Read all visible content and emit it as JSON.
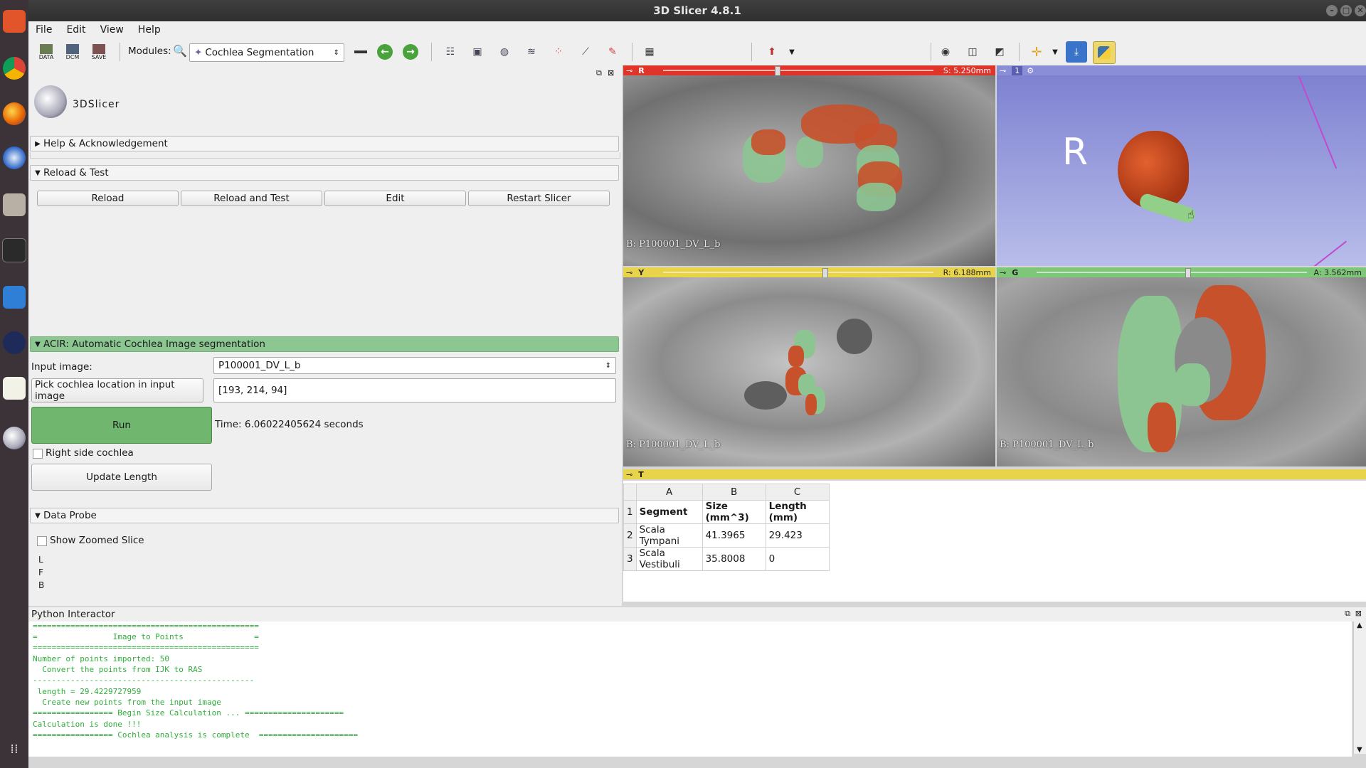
{
  "window": {
    "title": "3D Slicer 4.8.1"
  },
  "menu": [
    "File",
    "Edit",
    "View",
    "Help"
  ],
  "toolbar": {
    "data_label": "DATA",
    "dcm_label": "DCM",
    "save_label": "SAVE",
    "modules_label": "Modules:",
    "module_selected": "Cochlea Segmentation"
  },
  "logo": {
    "text": "3DSlicer"
  },
  "sections": {
    "help": "Help & Acknowledgement",
    "reload_test": "Reload & Test",
    "acir": "ACIR: Automatic Cochlea Image segmentation",
    "data_probe": "Data Probe"
  },
  "reload_buttons": [
    "Reload",
    "Reload and Test",
    "Edit",
    "Restart Slicer"
  ],
  "acir": {
    "input_image_label": "Input image:",
    "input_image_value": "P100001_DV_L_b",
    "pick_button": "Pick cochlea location in input image",
    "location_value": "[193, 214, 94]",
    "run_button": "Run",
    "time_text": "Time: 6.06022405624  seconds",
    "right_side_label": "Right side cochlea",
    "update_length_button": "Update Length"
  },
  "data_probe": {
    "show_zoomed_label": "Show Zoomed Slice",
    "lines": [
      "L",
      "F",
      "B"
    ]
  },
  "views": {
    "red": {
      "letter": "R",
      "offset": "S: 5.250mm",
      "label": "B: P100001_DV_L_b",
      "slider": 0.42
    },
    "threed": {
      "num": "1",
      "orient": "R"
    },
    "yellow": {
      "letter": "Y",
      "offset": "R: 6.188mm",
      "label": "B: P100001_DV_L_b",
      "slider": 0.6
    },
    "green": {
      "letter": "G",
      "offset": "A: 3.562mm",
      "label": "B: P100001_DV_L_b",
      "slider": 0.56
    },
    "table": {
      "letter": "T"
    }
  },
  "table": {
    "columns": [
      "A",
      "B",
      "C"
    ],
    "rows": [
      [
        "1",
        "Segment",
        "Size (mm^3)",
        "Length (mm)"
      ],
      [
        "2",
        "Scala Tympani",
        "41.3965",
        "29.423"
      ],
      [
        "3",
        "Scala Vestibuli",
        "35.8008",
        "0"
      ]
    ]
  },
  "python": {
    "title": "Python Interactor",
    "lines": [
      "================================================",
      "=                Image to Points               =",
      "================================================",
      "Number of points imported: 50",
      "  Convert the points from IJK to RAS",
      "-----------------------------------------------",
      " length = 29.4229727959",
      "  Create new points from the input image",
      "================= Begin Size Calculation ... =====================",
      "Calculation is done !!!",
      "================= Cochlea analysis is complete  ====================="
    ]
  },
  "colors": {
    "red_bar": "#e0342b",
    "yellow_bar": "#e8d44a",
    "green_bar": "#7ec779",
    "threed_bg": "#7b7fd0",
    "acir_header": "#8cc690",
    "run_button": "#71b66f",
    "console_text": "#2fae3a"
  }
}
